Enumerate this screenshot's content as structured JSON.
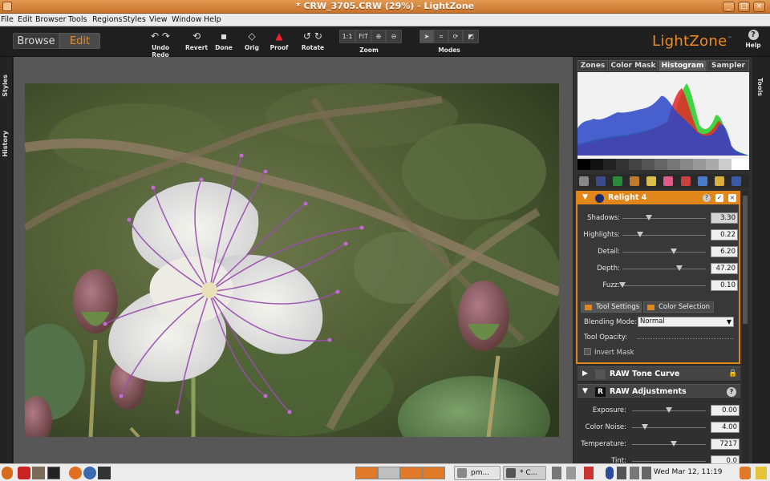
{
  "window": {
    "title": "* CRW_3705.CRW (29%) - LightZone",
    "buttons": [
      "_",
      "□",
      "×"
    ]
  },
  "menubar": [
    "File",
    "Edit",
    "Browser",
    "Tools",
    "Regions",
    "Styles",
    "View",
    "Window",
    "Help"
  ],
  "toolbar": {
    "browse_label": "Browse",
    "edit_label": "Edit",
    "undo_redo_label": "Undo Redo",
    "revert_label": "Revert",
    "done_label": "Done",
    "orig_label": "Orig",
    "proof_label": "Proof",
    "rotate_label": "Rotate",
    "zoom_1to1": "1:1",
    "zoom_fit": "FIT",
    "zoom_label": "Zoom",
    "modes_label": "Modes",
    "logo": "LightZone",
    "logo_tm": "™",
    "help_label": "Help"
  },
  "left_rail": {
    "styles": "Styles",
    "history": "History"
  },
  "right_rail": {
    "tools": "Tools"
  },
  "right_panel": {
    "tabs": [
      "Zones",
      "Color Mask",
      "Histogram",
      "Sampler"
    ],
    "active_tab": "Histogram",
    "relight": {
      "title": "Relight 4",
      "help": "?",
      "check": "✓",
      "close": "×",
      "sliders": [
        {
          "label": "Shadows:",
          "value": "3.30",
          "pos": 0.3
        },
        {
          "label": "Highlights:",
          "value": "0.22",
          "pos": 0.22
        },
        {
          "label": "Detail:",
          "value": "6.20",
          "pos": 0.62
        },
        {
          "label": "Depth:",
          "value": "47.20",
          "pos": 0.68
        },
        {
          "label": "Fuzz:",
          "value": "0.10",
          "pos": 0.0
        }
      ],
      "subtabs": [
        "Tool Settings",
        "Color Selection"
      ],
      "blending_label": "Blending Mode:",
      "blending_value": "Normal",
      "opacity_label": "Tool Opacity:",
      "invert_label": "Invert Mask"
    },
    "raw_tone_curve": "RAW Tone Curve",
    "raw_adjustments": {
      "title": "RAW Adjustments",
      "icon_letter": "R",
      "help": "?",
      "rows": [
        {
          "label": "Exposure:",
          "value": "0.00",
          "pos": 0.5
        },
        {
          "label": "Color Noise:",
          "value": "4.00",
          "pos": 0.1
        },
        {
          "label": "Temperature:",
          "value": "7217",
          "pos": 0.6
        },
        {
          "label": "Tint:",
          "value": "0.0",
          "pos": 0.5
        }
      ]
    }
  },
  "taskbar": {
    "task1": "pm...",
    "task2": "* C...",
    "clock": "Wed Mar 12, 11:19"
  }
}
